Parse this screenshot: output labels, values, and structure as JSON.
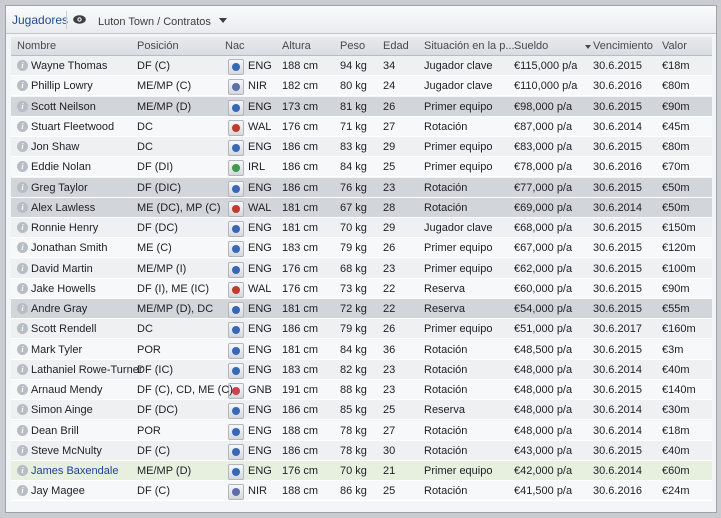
{
  "panel": {
    "title": "Jugadores",
    "breadcrumb": "Luton Town / Contratos"
  },
  "colors": {
    "ENG": "#3867b5",
    "NIR": "#5b6ea8",
    "WAL": "#c23a2d",
    "IRL": "#3c9b4c",
    "GNB": "#d04050",
    "link": "#1d3f9b"
  },
  "columns": [
    "Nombre",
    "Posición",
    "Nac",
    "Altura",
    "Peso",
    "Edad",
    "Situación en la p...",
    "Sueldo",
    "Vencimiento",
    "Valor"
  ],
  "players": [
    [
      "Wayne Thomas",
      "DF (C)",
      "ENG",
      "188 cm",
      "94 kg",
      "34",
      "Jugador clave",
      "€115,000 p/a",
      "30.6.2015",
      "€18m"
    ],
    [
      "Phillip Lowry",
      "ME/MP (C)",
      "NIR",
      "182 cm",
      "80 kg",
      "24",
      "Jugador clave",
      "€110,000 p/a",
      "30.6.2016",
      "€80m"
    ],
    [
      "Scott Neilson",
      "ME/MP (D)",
      "ENG",
      "173 cm",
      "81 kg",
      "26",
      "Primer equipo",
      "€98,000 p/a",
      "30.6.2015",
      "€90m"
    ],
    [
      "Stuart Fleetwood",
      "DC",
      "WAL",
      "176 cm",
      "71 kg",
      "27",
      "Rotación",
      "€87,000 p/a",
      "30.6.2014",
      "€45m"
    ],
    [
      "Jon Shaw",
      "DC",
      "ENG",
      "186 cm",
      "83 kg",
      "29",
      "Primer equipo",
      "€83,000 p/a",
      "30.6.2015",
      "€80m"
    ],
    [
      "Eddie Nolan",
      "DF (DI)",
      "IRL",
      "186 cm",
      "84 kg",
      "25",
      "Primer equipo",
      "€78,000 p/a",
      "30.6.2016",
      "€70m"
    ],
    [
      "Greg Taylor",
      "DF (DIC)",
      "ENG",
      "186 cm",
      "76 kg",
      "23",
      "Rotación",
      "€77,000 p/a",
      "30.6.2015",
      "€50m"
    ],
    [
      "Alex Lawless",
      "ME (DC), MP (C)",
      "WAL",
      "181 cm",
      "67 kg",
      "28",
      "Rotación",
      "€69,000 p/a",
      "30.6.2014",
      "€50m"
    ],
    [
      "Ronnie Henry",
      "DF (DC)",
      "ENG",
      "181 cm",
      "70 kg",
      "29",
      "Jugador clave",
      "€68,000 p/a",
      "30.6.2015",
      "€150m"
    ],
    [
      "Jonathan Smith",
      "ME (C)",
      "ENG",
      "183 cm",
      "79 kg",
      "26",
      "Primer equipo",
      "€67,000 p/a",
      "30.6.2015",
      "€120m"
    ],
    [
      "David Martin",
      "ME/MP (I)",
      "ENG",
      "176 cm",
      "68 kg",
      "23",
      "Primer equipo",
      "€62,000 p/a",
      "30.6.2015",
      "€100m"
    ],
    [
      "Jake Howells",
      "DF (I), ME (IC)",
      "WAL",
      "176 cm",
      "73 kg",
      "22",
      "Reserva",
      "€60,000 p/a",
      "30.6.2015",
      "€90m"
    ],
    [
      "Andre Gray",
      "ME/MP (D), DC",
      "ENG",
      "181 cm",
      "72 kg",
      "22",
      "Reserva",
      "€54,000 p/a",
      "30.6.2015",
      "€55m"
    ],
    [
      "Scott Rendell",
      "DC",
      "ENG",
      "186 cm",
      "79 kg",
      "26",
      "Primer equipo",
      "€51,000 p/a",
      "30.6.2017",
      "€160m"
    ],
    [
      "Mark Tyler",
      "POR",
      "ENG",
      "181 cm",
      "84 kg",
      "36",
      "Rotación",
      "€48,500 p/a",
      "30.6.2015",
      "€3m"
    ],
    [
      "Lathaniel Rowe-Turner",
      "DF (IC)",
      "ENG",
      "183 cm",
      "82 kg",
      "23",
      "Rotación",
      "€48,000 p/a",
      "30.6.2014",
      "€40m"
    ],
    [
      "Arnaud Mendy",
      "DF (C), CD, ME (C)",
      "GNB",
      "191 cm",
      "88 kg",
      "23",
      "Rotación",
      "€48,000 p/a",
      "30.6.2015",
      "€140m"
    ],
    [
      "Simon Ainge",
      "DF (DC)",
      "ENG",
      "186 cm",
      "85 kg",
      "25",
      "Reserva",
      "€48,000 p/a",
      "30.6.2014",
      "€30m"
    ],
    [
      "Dean Brill",
      "POR",
      "ENG",
      "188 cm",
      "78 kg",
      "27",
      "Rotación",
      "€48,000 p/a",
      "30.6.2014",
      "€18m"
    ],
    [
      "Steve McNulty",
      "DF (C)",
      "ENG",
      "186 cm",
      "78 kg",
      "30",
      "Rotación",
      "€43,000 p/a",
      "30.6.2015",
      "€40m"
    ],
    [
      "James Baxendale",
      "ME/MP (D)",
      "ENG",
      "176 cm",
      "70 kg",
      "21",
      "Primer equipo",
      "€42,000 p/a",
      "30.6.2014",
      "€60m"
    ],
    [
      "Jay Magee",
      "DF (C)",
      "NIR",
      "188 cm",
      "86 kg",
      "25",
      "Rotación",
      "€41,500 p/a",
      "30.6.2016",
      "€24m"
    ]
  ]
}
